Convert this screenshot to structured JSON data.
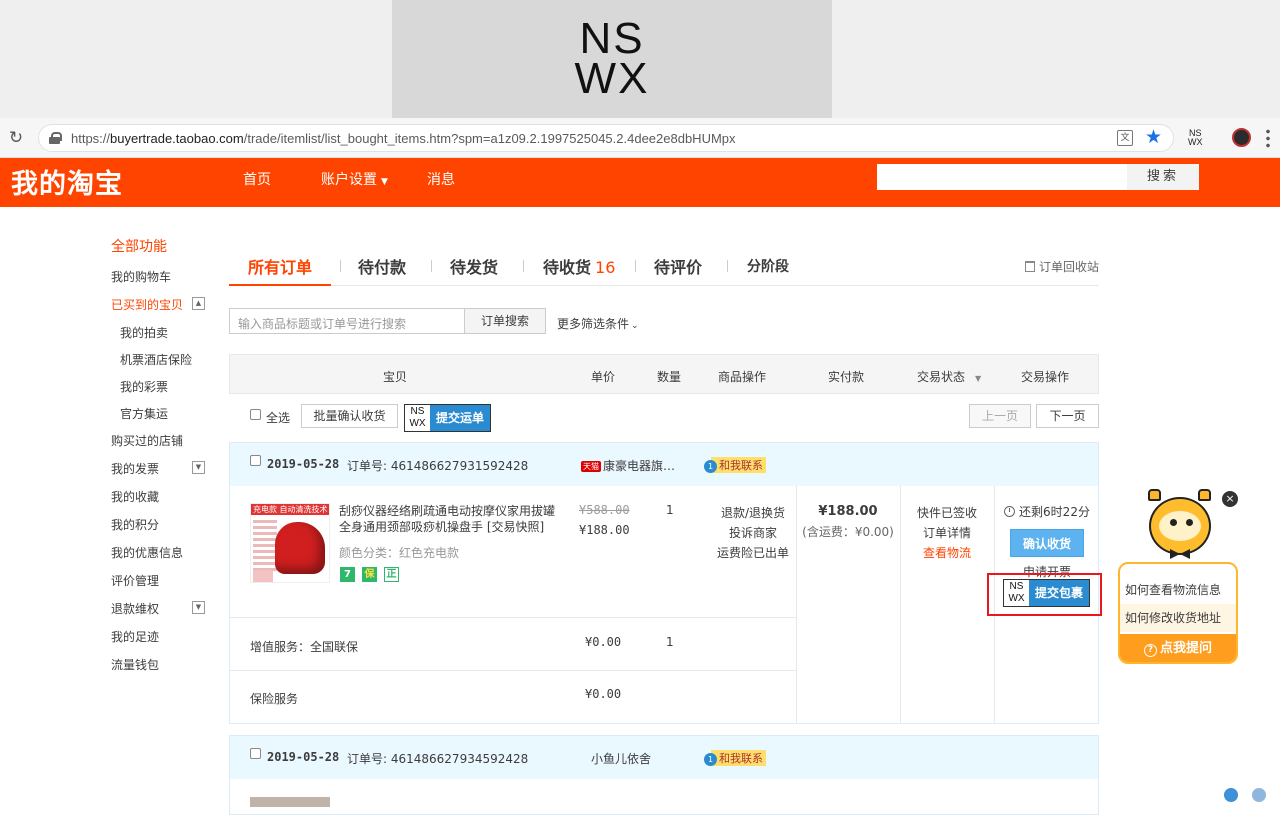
{
  "extension_banner": {
    "line1": "NS",
    "line2": "WX"
  },
  "browser": {
    "url_prefix": "https://",
    "url_host": "buyertrade.taobao.com",
    "url_path": "/trade/itemlist/list_bought_items.htm?spm=a1z09.2.1997525045.2.4dee2e8dbHUMpx",
    "translate_icon": "translate-icon",
    "bookmark_icon": "star-icon",
    "ext_line1": "NS",
    "ext_line2": "WX"
  },
  "header": {
    "brand": "我的淘宝",
    "nav": [
      "首页",
      "账户设置",
      "消息"
    ],
    "search_button": "搜索",
    "bg_color": "#ff4400"
  },
  "sidebar": {
    "items": [
      {
        "label": "全部功能"
      },
      {
        "label": "我的购物车"
      },
      {
        "label": "已买到的宝贝"
      },
      {
        "label": "我的拍卖"
      },
      {
        "label": "机票酒店保险"
      },
      {
        "label": "我的彩票"
      },
      {
        "label": "官方集运"
      },
      {
        "label": "购买过的店铺"
      },
      {
        "label": "我的发票"
      },
      {
        "label": "我的收藏"
      },
      {
        "label": "我的积分"
      },
      {
        "label": "我的优惠信息"
      },
      {
        "label": "评价管理"
      },
      {
        "label": "退款维权"
      },
      {
        "label": "我的足迹"
      },
      {
        "label": "流量钱包"
      }
    ]
  },
  "tabs": {
    "items": [
      "所有订单",
      "待付款",
      "待发货",
      "待收货",
      "待评价",
      "分阶段"
    ],
    "pending_receive_count": "16",
    "recycle": "订单回收站"
  },
  "order_search": {
    "placeholder": "输入商品标题或订单号进行搜索",
    "button": "订单搜索",
    "more_filters": "更多筛选条件"
  },
  "table_header": [
    "宝贝",
    "单价",
    "数量",
    "商品操作",
    "实付款",
    "交易状态",
    "交易操作"
  ],
  "batch": {
    "select_all": "全选",
    "batch_confirm": "批量确认收货",
    "nswx_line1": "NS",
    "nswx_line2": "WX",
    "submit_waybill": "提交运单",
    "prev_page": "上一页",
    "next_page": "下一页"
  },
  "orders": [
    {
      "date": "2019-05-28",
      "order_no": "订单号: 461486627931592428",
      "shop": "康豪电器旗…",
      "tmall_tag": "天猫",
      "contact": "和我联系",
      "title": "刮痧仪器经络刷疏通电动按摩仪家用拔罐全身通用颈部吸痧机操盘手 [交易快照]",
      "attr": "颜色分类：红色充电款",
      "thumb_tag": "充电款 自动清洗技术",
      "service_icons": [
        "7",
        "保",
        "正"
      ],
      "original_price": "¥588.00",
      "price": "¥188.00",
      "qty": "1",
      "item_ops": [
        "退款/退换货",
        "投诉商家",
        "运费险已出单"
      ],
      "total": "¥188.00",
      "shipping": "(含运费：¥0.00)",
      "status": [
        "快件已签收",
        "订单详情"
      ],
      "logistics_link": "查看物流",
      "remaining": "还剩6时22分",
      "confirm": "确认收货",
      "apply": "申请开票",
      "nswx_line1": "NS",
      "nswx_line2": "WX",
      "submit_package": "提交包裹",
      "value_added": {
        "label": "增值服务：全国联保",
        "price": "¥0.00",
        "qty": "1"
      },
      "insurance": {
        "label": "保险服务",
        "price": "¥0.00"
      }
    },
    {
      "date": "2019-05-28",
      "order_no": "订单号: 461486627934592428",
      "shop": "小鱼儿依舍",
      "contact": "和我联系"
    }
  ],
  "assistant": {
    "q1": "如何查看物流信息",
    "q2": "如何修改收货地址",
    "ask": "点我提问",
    "close": "×",
    "accent": "#ff9d1f"
  }
}
